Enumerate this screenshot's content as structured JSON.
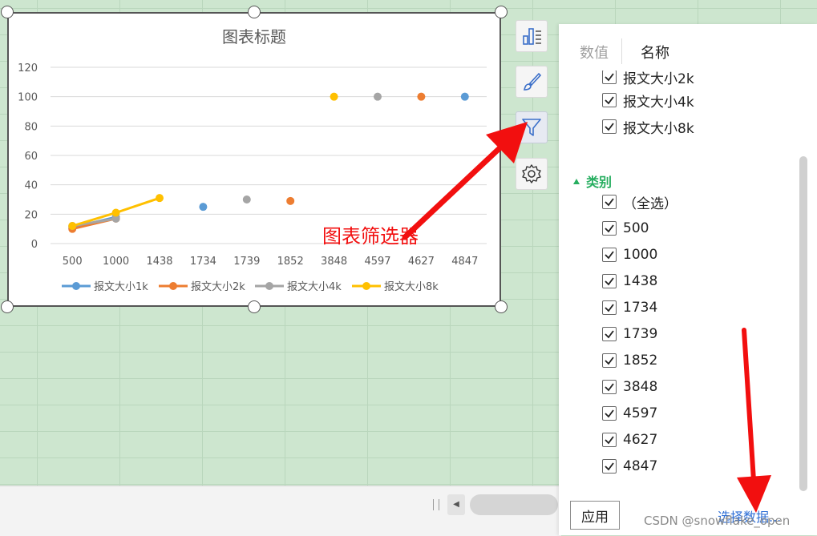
{
  "chart_data": {
    "type": "line",
    "title": "图表标题",
    "categories": [
      "500",
      "1000",
      "1438",
      "1734",
      "1739",
      "1852",
      "3848",
      "4597",
      "4627",
      "4847"
    ],
    "ylim": [
      0,
      120
    ],
    "yticks": [
      "0",
      "20",
      "40",
      "60",
      "80",
      "100",
      "120"
    ],
    "grid": true,
    "legend_position": "bottom",
    "series": [
      {
        "name": "报文大小1k",
        "color": "#5b9bd5",
        "values": [
          11,
          18,
          null,
          25,
          null,
          null,
          null,
          null,
          null,
          100
        ]
      },
      {
        "name": "报文大小2k",
        "color": "#ed7d31",
        "values": [
          10,
          17,
          null,
          null,
          null,
          29,
          null,
          null,
          100,
          null
        ]
      },
      {
        "name": "报文大小4k",
        "color": "#a5a5a5",
        "values": [
          12,
          17,
          null,
          null,
          30,
          null,
          null,
          100,
          null,
          null
        ]
      },
      {
        "name": "报文大小8k",
        "color": "#ffc000",
        "values": [
          12,
          21,
          31,
          null,
          null,
          null,
          100,
          null,
          null,
          null
        ]
      }
    ]
  },
  "tools": {
    "chart_elements": "chart-elements-icon",
    "chart_style": "brush-icon",
    "chart_filter": "filter-icon",
    "chart_settings": "gear-icon"
  },
  "panel": {
    "tabs": [
      "数值",
      "名称"
    ],
    "series_items": [
      {
        "label": "报文大小2k",
        "checked": true
      },
      {
        "label": "报文大小4k",
        "checked": true
      },
      {
        "label": "报文大小8k",
        "checked": true
      }
    ],
    "category_title": "类别",
    "category_items": [
      {
        "label": "（全选）",
        "checked": true
      },
      {
        "label": "500",
        "checked": true
      },
      {
        "label": "1000",
        "checked": true
      },
      {
        "label": "1438",
        "checked": true
      },
      {
        "label": "1734",
        "checked": true
      },
      {
        "label": "1739",
        "checked": true
      },
      {
        "label": "1852",
        "checked": true
      },
      {
        "label": "3848",
        "checked": true
      },
      {
        "label": "4597",
        "checked": true
      },
      {
        "label": "4627",
        "checked": true
      },
      {
        "label": "4847",
        "checked": true
      }
    ],
    "apply_label": "应用",
    "select_data_label": "选择数据..."
  },
  "annotation": {
    "label": "图表筛选器",
    "color": "#f20f0f"
  },
  "watermark": "CSDN @snowflake_open"
}
